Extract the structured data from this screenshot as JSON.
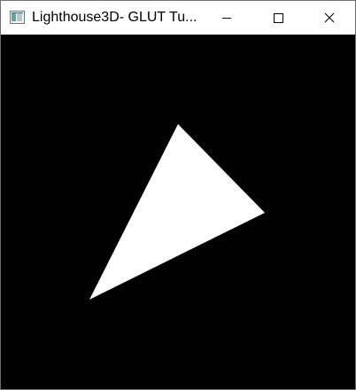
{
  "window": {
    "title": "Lighthouse3D- GLUT Tu...",
    "controls": {
      "minimize": "minimize-icon",
      "maximize": "maximize-icon",
      "close": "close-icon"
    }
  },
  "scene": {
    "background_color": "#000000",
    "shape": "triangle",
    "shape_color": "#ffffff"
  }
}
